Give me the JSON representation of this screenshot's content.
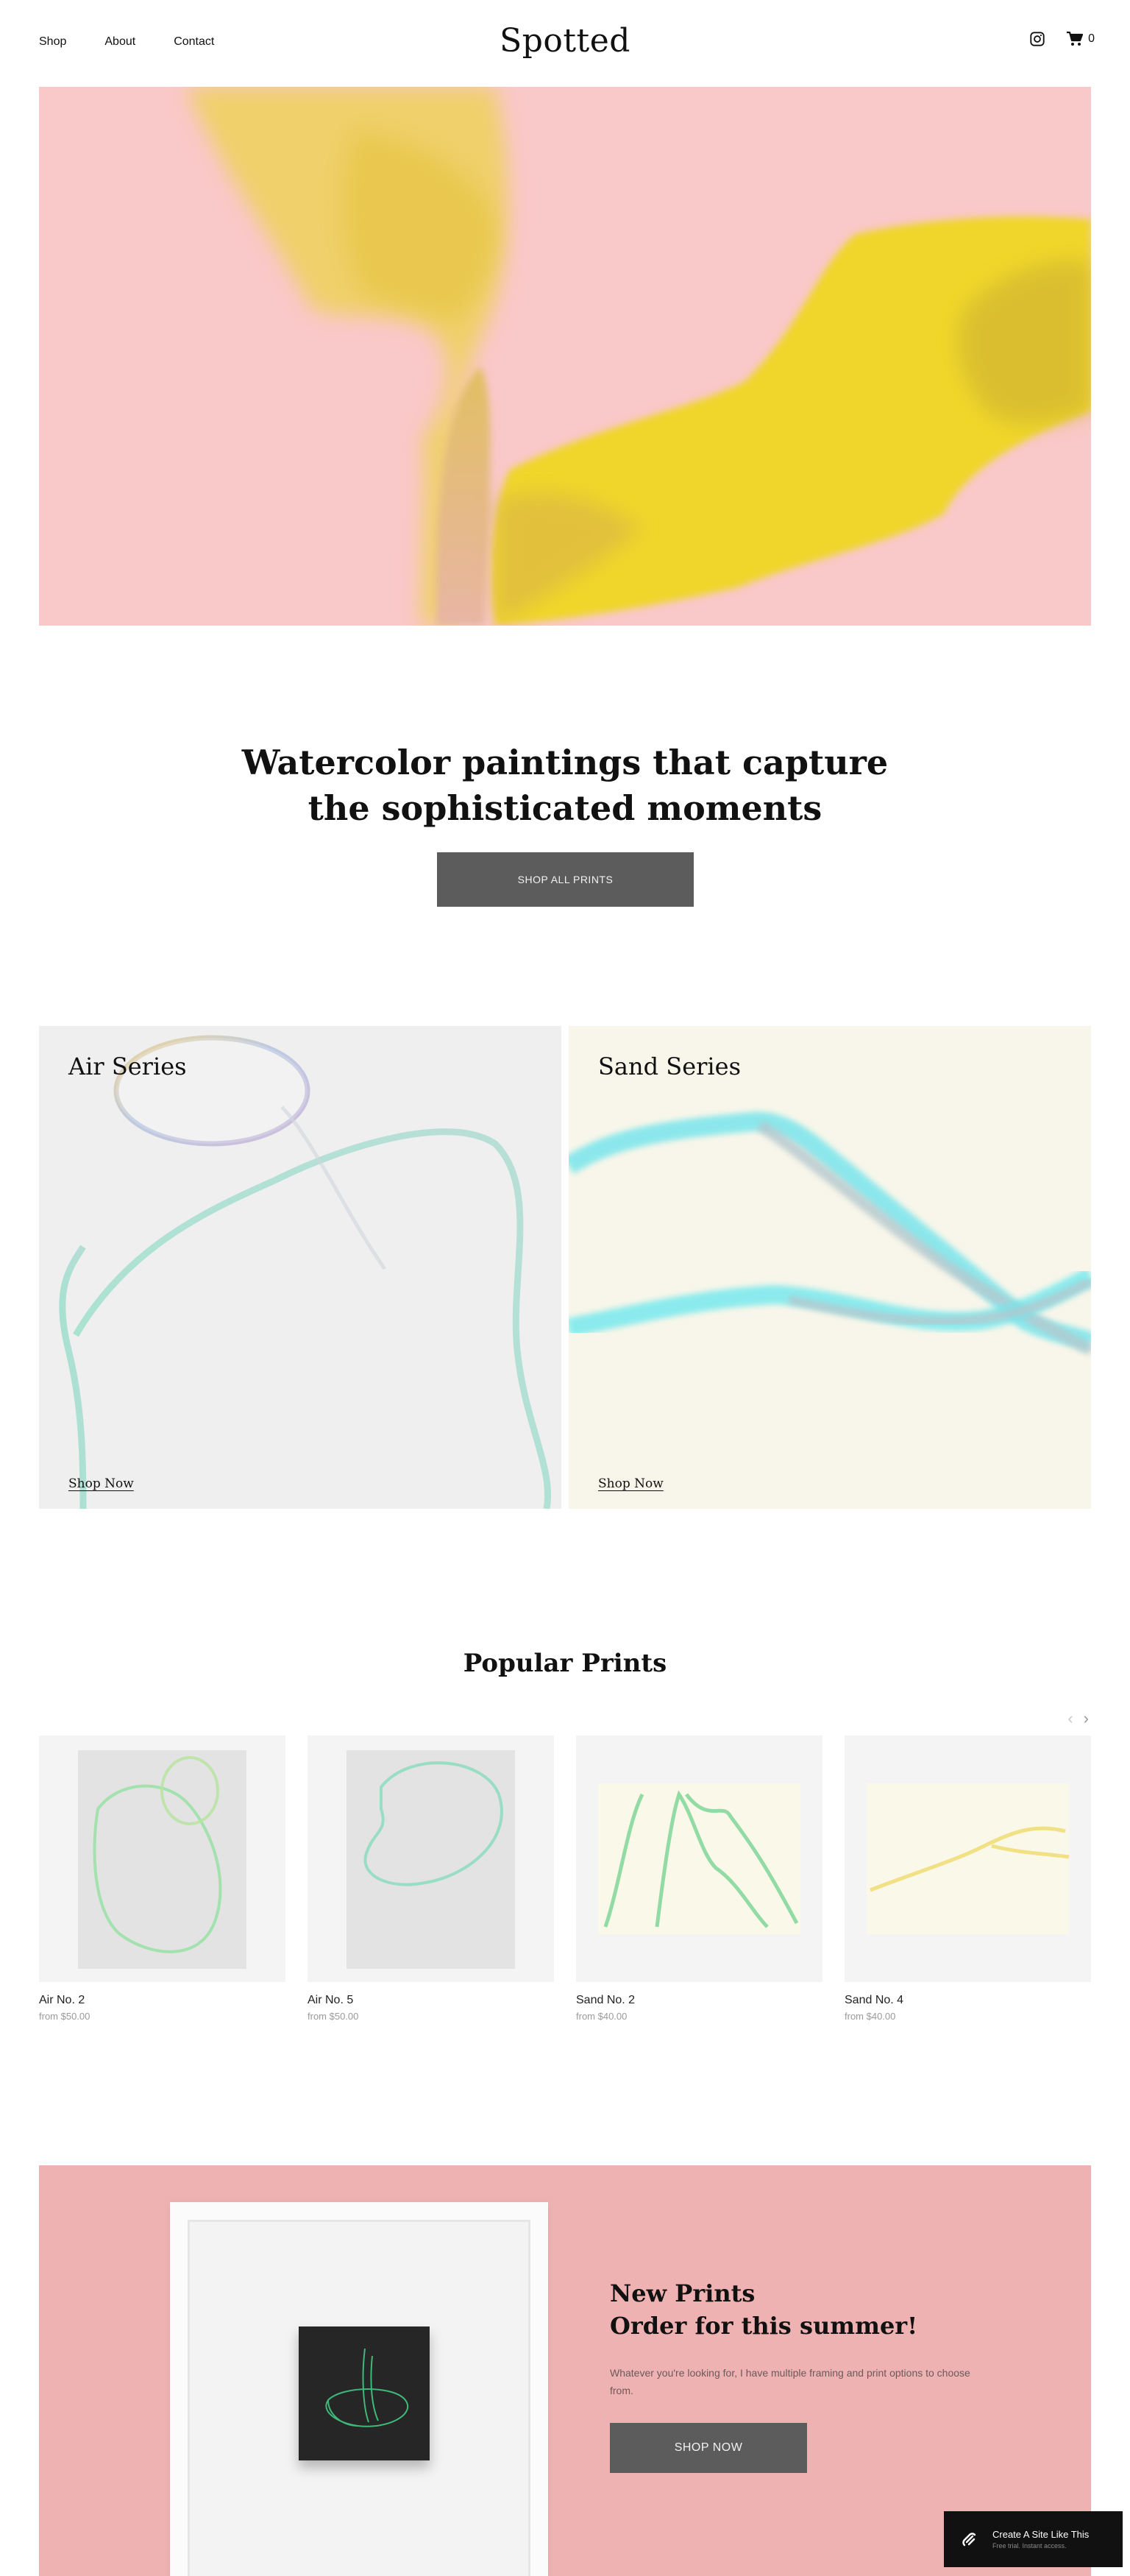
{
  "site": {
    "logo": "Spotted"
  },
  "nav": {
    "items": [
      "Shop",
      "About",
      "Contact"
    ]
  },
  "header": {
    "cart_count": "0",
    "icons": [
      "instagram-icon",
      "cart-icon"
    ]
  },
  "intro": {
    "title_line1": "Watercolor paintings that capture",
    "title_line2": "the sophisticated moments",
    "button": "SHOP ALL PRINTS"
  },
  "series": [
    {
      "title": "Air Series",
      "link": "Shop Now"
    },
    {
      "title": "Sand Series",
      "link": "Shop Now"
    }
  ],
  "popular": {
    "title": "Popular Prints",
    "products": [
      {
        "name": "Air No. 2",
        "price": "from $50.00"
      },
      {
        "name": "Air No. 5",
        "price": "from $50.00"
      },
      {
        "name": "Sand No. 2",
        "price": "from $40.00"
      },
      {
        "name": "Sand No. 4",
        "price": "from $40.00"
      }
    ]
  },
  "new_prints": {
    "title_line1": "New Prints",
    "title_line2": "Order for this summer!",
    "description": "Whatever you're looking for, I have multiple framing and print options to choose from.",
    "button": "SHOP NOW"
  },
  "badge": {
    "title": "Create A Site Like This",
    "subtitle": "Free trial. Instant access."
  },
  "colors": {
    "hero_bg": "#f9c8c9",
    "hero_yellow": "#f0d62a",
    "button_bg": "#5c5c5c",
    "air_bg": "#efefef",
    "sand_bg": "#f8f6ea",
    "banner_bg": "#efb2b2",
    "badge_bg": "#111111"
  }
}
